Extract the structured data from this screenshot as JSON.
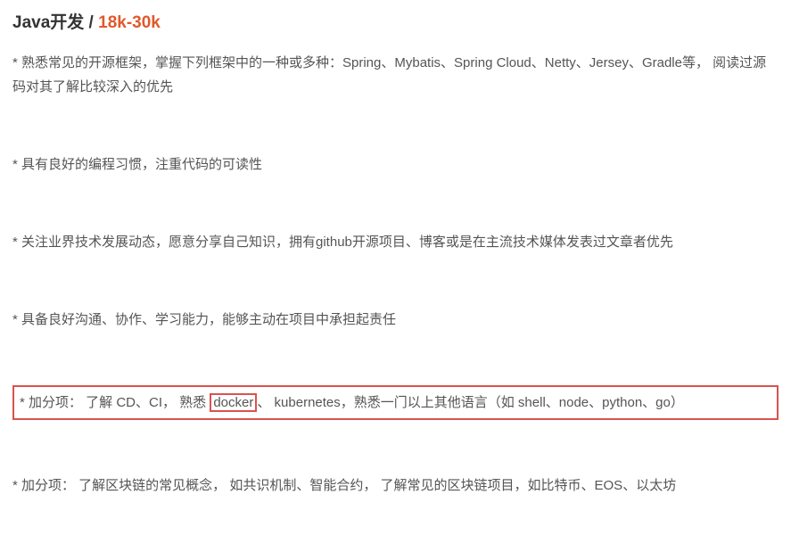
{
  "header": {
    "job_title": "Java开发",
    "separator": " / ",
    "salary": "18k-30k"
  },
  "items": {
    "item1": "* 熟悉常见的开源框架，掌握下列框架中的一种或多种：Spring、Mybatis、Spring Cloud、Netty、Jersey、Gradle等， 阅读过源码对其了解比较深入的优先",
    "item2": "* 具有良好的编程习惯，注重代码的可读性",
    "item3": "* 关注业界技术发展动态，愿意分享自己知识，拥有github开源项目、博客或是在主流技术媒体发表过文章者优先",
    "item4": "* 具备良好沟通、协作、学习能力，能够主动在项目中承担起责任",
    "item5_pre": "* 加分项： 了解 CD、CI， 熟悉 ",
    "item5_highlight": "docker",
    "item5_post": "、  kubernetes，熟悉一门以上其他语言（如 shell、node、python、go）",
    "item6": "* 加分项： 了解区块链的常见概念， 如共识机制、智能合约， 了解常见的区块链项目，如比特币、EOS、以太坊"
  }
}
